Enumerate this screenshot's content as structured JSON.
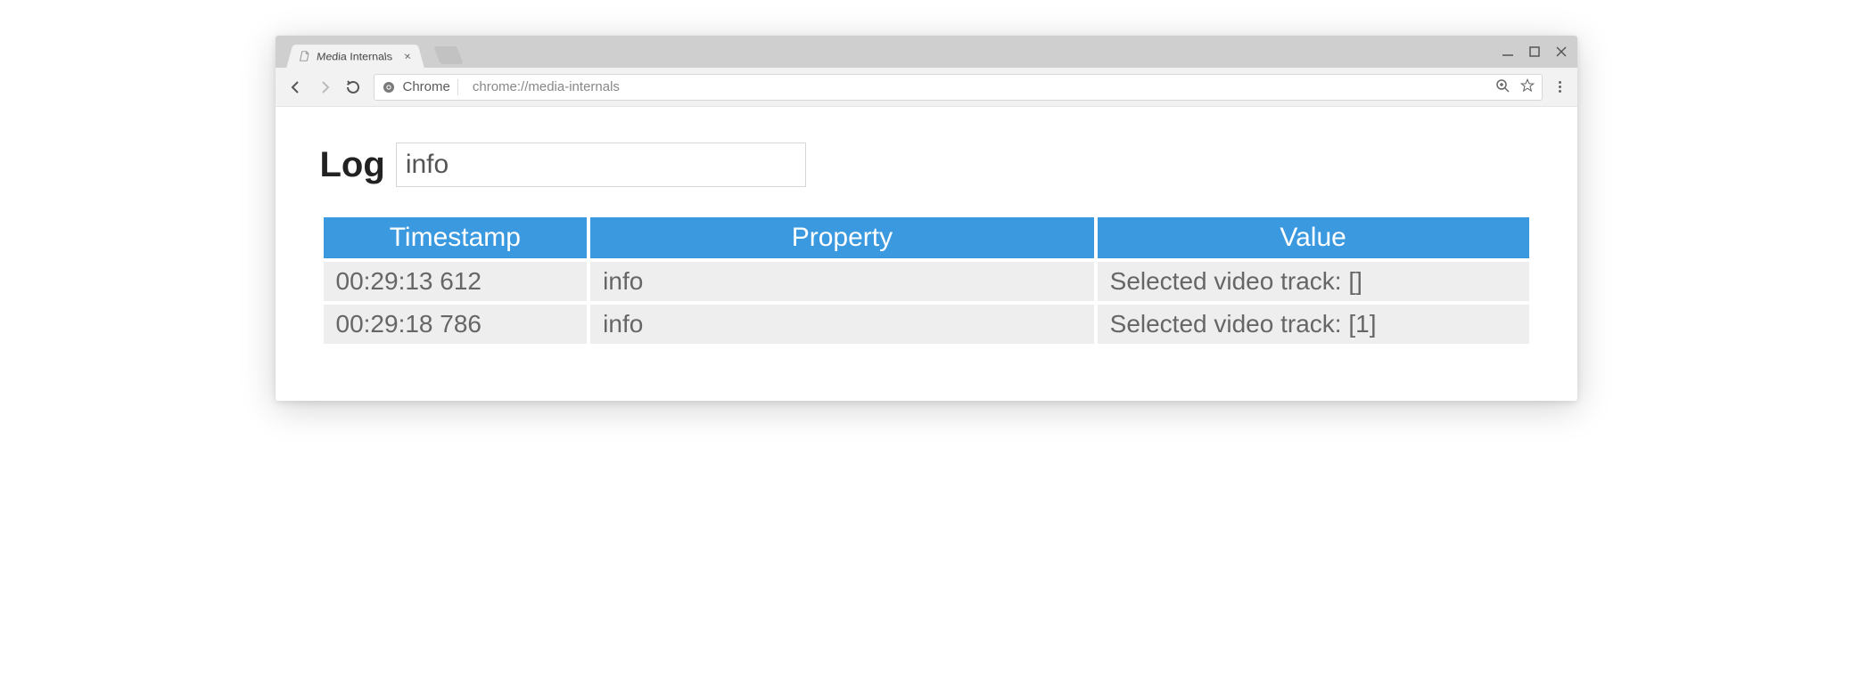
{
  "browser": {
    "tab_title": "Media Internals",
    "omnibox": {
      "scheme_label": "Chrome",
      "url_path": "chrome://media-internals"
    }
  },
  "page": {
    "heading": "Log",
    "filter_value": "info"
  },
  "table": {
    "headers": {
      "timestamp": "Timestamp",
      "property": "Property",
      "value": "Value"
    },
    "rows": [
      {
        "timestamp": "00:29:13 612",
        "property": "info",
        "value": "Selected video track: []"
      },
      {
        "timestamp": "00:29:18 786",
        "property": "info",
        "value": "Selected video track: [1]"
      }
    ]
  }
}
